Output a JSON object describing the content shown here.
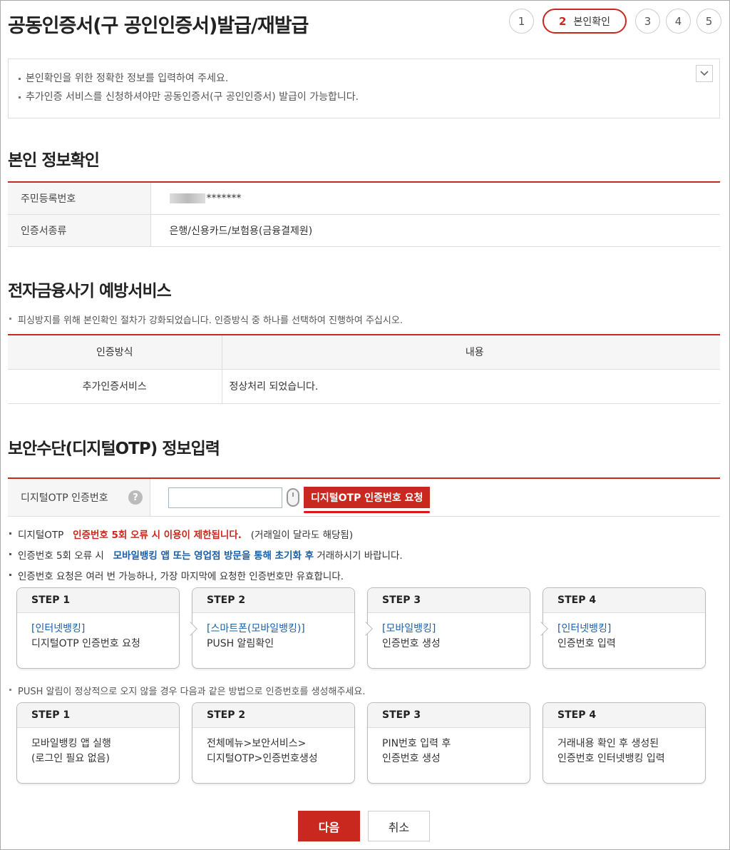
{
  "page": {
    "title": "공동인증서(구 공인인증서)발급/재발급"
  },
  "steps": {
    "s1": "1",
    "s2_num": "2",
    "s2_label": "본인확인",
    "s3": "3",
    "s4": "4",
    "s5": "5"
  },
  "notice": {
    "line1": "본인확인을 위한 정확한 정보를 입력하여 주세요.",
    "line2": "추가인증 서비스를 신청하셔야만 공동인증서(구 공인인증서) 발급이 가능합니다.",
    "toggle_icon": "chevron-down-icon"
  },
  "identity": {
    "title": "본인 정보확인",
    "rrn_label": "주민등록번호",
    "rrn_value": "*******",
    "cert_type_label": "인증서종류",
    "cert_type_value": "은행/신용카드/보험용(금융결제원)"
  },
  "fraud": {
    "title": "전자금융사기 예방서비스",
    "desc": "피싱방지를 위해 본인확인 절차가 강화되었습니다. 인증방식 중 하나를 선택하여 진행하여 주십시오.",
    "col_method": "인증방식",
    "col_content": "내용",
    "row_method": "추가인증서비스",
    "row_content": "정상처리 되었습니다."
  },
  "otp": {
    "title": "보안수단(디지털OTP) 정보입력",
    "field_label": "디지털OTP 인증번호",
    "help_icon": "?",
    "input_value": "",
    "request_button": "디지털OTP 인증번호 요청",
    "warn1_a": "디지털OTP",
    "warn1_b": "인증번호 5회 오류 시 이용이 제한됩니다.",
    "warn1_c": "(거래일이 달라도 해당됨)",
    "warn2_a": "인증번호 5회 오류 시",
    "warn2_b": "모바일뱅킹 앱 또는 영업점 방문을 통해 초기화 후",
    "warn2_c": "거래하시기 바랍니다.",
    "warn3": "인증번호 요청은 여러 번 가능하나, 가장 마지막에 요청한 인증번호만 유효합니다."
  },
  "flow1": [
    {
      "step": "STEP 1",
      "link": "[인터넷뱅킹]",
      "text": "디지털OTP 인증번호 요청"
    },
    {
      "step": "STEP 2",
      "link": "[스마트폰(모바일뱅킹)]",
      "text": "PUSH 알림확인"
    },
    {
      "step": "STEP 3",
      "link": "[모바일뱅킹]",
      "text": "인증번호 생성"
    },
    {
      "step": "STEP 4",
      "link": "[인터넷뱅킹]",
      "text": "인증번호 입력"
    }
  ],
  "push_notice": "PUSH 알림이 정상적으로 오지 않을 경우 다음과 같은 방법으로 인증번호를 생성해주세요.",
  "flow2": [
    {
      "step": "STEP 1",
      "line1": "모바일뱅킹 앱 실행",
      "line2": "(로그인 필요 없음)"
    },
    {
      "step": "STEP 2",
      "line1": "전체메뉴>보안서비스>",
      "line2": "디지털OTP>인증번호생성"
    },
    {
      "step": "STEP 3",
      "line1": "PIN번호 입력 후",
      "line2": "인증번호 생성"
    },
    {
      "step": "STEP 4",
      "line1": "거래내용 확인 후 생성된",
      "line2": "인증번호 인터넷뱅킹 입력"
    }
  ],
  "buttons": {
    "next": "다음",
    "cancel": "취소"
  },
  "colors": {
    "accent": "#c8281e",
    "link": "#1a5fa8"
  }
}
